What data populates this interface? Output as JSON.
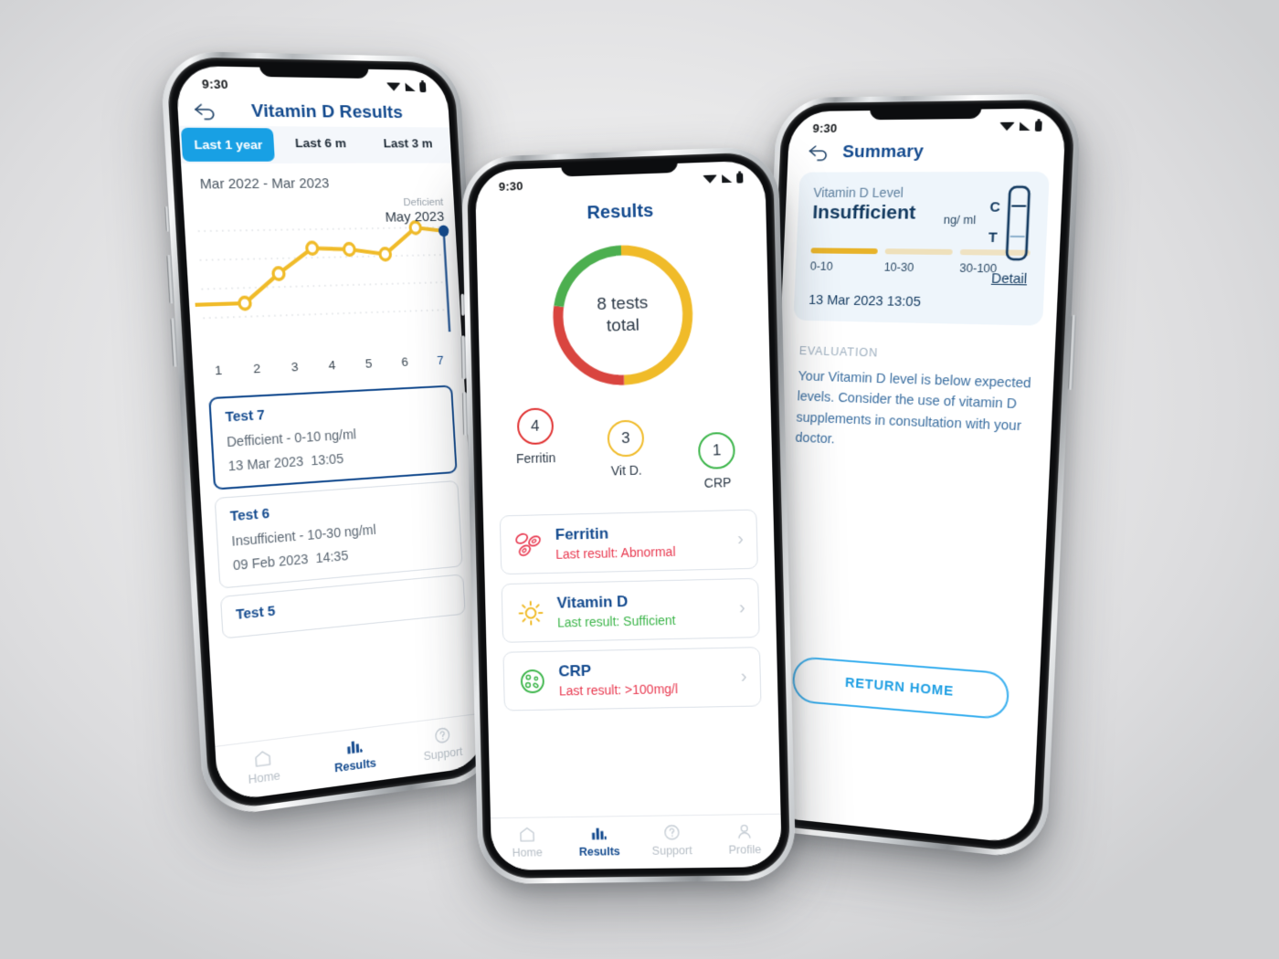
{
  "background": {
    "from": "#f2f2f3",
    "to": "#cfd0d2"
  },
  "brand": {
    "navy": "#134a8e",
    "blue": "#18a0e4",
    "yellow": "#f0bb29",
    "red": "#dc3c3c",
    "green": "#3cb54a"
  },
  "phone_left": {
    "status": {
      "time": "9:30",
      "wifi": "wifi-icon",
      "signal": "signal-icon",
      "battery": "battery-icon"
    },
    "header": {
      "back": "back-arrow-icon",
      "title": "Vitamin D Results"
    },
    "tabs": [
      {
        "label": "Last 1 year",
        "active": true
      },
      {
        "label": "Last 6 m",
        "active": false
      },
      {
        "label": "Last 3 m",
        "active": false
      }
    ],
    "range_label": "Mar 2022 - Mar 2023",
    "chart_annotation": {
      "status": "Deficient",
      "date": "May 2023"
    },
    "tests": [
      {
        "title": "Test 7",
        "result": "Defficient - 0-10 ng/ml",
        "date": "13  Mar 2023",
        "time": "13:05",
        "active": true
      },
      {
        "title": "Test 6",
        "result": "Insufficient - 10-30 ng/ml",
        "date": "09 Feb 2023",
        "time": "14:35",
        "active": false
      },
      {
        "title": "Test 5",
        "result": "",
        "date": "",
        "time": "",
        "active": false
      }
    ],
    "nav": [
      {
        "label": "Home",
        "icon": "home-icon",
        "active": false
      },
      {
        "label": "Results",
        "icon": "bar-chart-icon",
        "active": true
      },
      {
        "label": "Support",
        "icon": "question-circle-icon",
        "active": false
      }
    ]
  },
  "chart_data": {
    "type": "line",
    "title": "Vitamin D Results",
    "subtitle": "Mar 2022 - Mar 2023",
    "xlabel": "",
    "ylabel": "",
    "x": [
      "1",
      "2",
      "3",
      "4",
      "5",
      "6",
      "7"
    ],
    "categories": [
      "1",
      "2",
      "3",
      "4",
      "5",
      "6",
      "7"
    ],
    "values": [
      18,
      34,
      52,
      50,
      47,
      64,
      62
    ],
    "ylim": [
      0,
      80
    ],
    "grid": true,
    "grid_style": "dotted-horizontal",
    "series": [
      {
        "name": "Vitamin D level",
        "color": "#f0bb29",
        "values": [
          18,
          34,
          52,
          50,
          47,
          64,
          62
        ]
      }
    ],
    "highlight": {
      "index": 7,
      "label": "7",
      "color": "#134a8e",
      "annotation_status": "Deficient",
      "annotation_date": "May 2023"
    },
    "legend": "none"
  },
  "phone_center": {
    "status": {
      "time": "9:30"
    },
    "title": "Results",
    "donut": {
      "center_line1": "8 tests",
      "center_line2": "total",
      "total": 8,
      "segments": [
        {
          "name": "Vit D.",
          "value": 4,
          "color": "#f0bb29"
        },
        {
          "name": "Ferritin",
          "value": 3,
          "color": "#dc3c3c"
        },
        {
          "name": "CRP",
          "value": 1,
          "color": "#3cb54a"
        }
      ]
    },
    "counters": [
      {
        "count": "4",
        "label": "Ferritin",
        "color": "#e03232"
      },
      {
        "count": "3",
        "label": "Vit D.",
        "color": "#f0bb29"
      },
      {
        "count": "1",
        "label": "CRP",
        "color": "#3cb54a"
      }
    ],
    "cards": [
      {
        "icon": "blood-cells-icon",
        "name": "Ferritin",
        "sub": "Last result: Abnormal",
        "sub_color": "#e8384f",
        "icon_color": "#e8384f"
      },
      {
        "icon": "sun-icon",
        "name": "Vitamin D",
        "sub": "Last result: Sufficient",
        "sub_color": "#3cb54a",
        "icon_color": "#f0bb29"
      },
      {
        "icon": "crp-cell-icon",
        "name": "CRP",
        "sub": "Last result:  >100mg/l",
        "sub_color": "#e8384f",
        "icon_color": "#3cb54a"
      }
    ],
    "nav": [
      {
        "label": "Home",
        "icon": "home-icon",
        "active": false
      },
      {
        "label": "Results",
        "icon": "bar-chart-icon",
        "active": true
      },
      {
        "label": "Support",
        "icon": "question-circle-icon",
        "active": false
      },
      {
        "label": "Profile",
        "icon": "person-icon",
        "active": false
      }
    ]
  },
  "phone_right": {
    "status": {
      "time": "9:30"
    },
    "header": {
      "back": "back-arrow-icon",
      "title": "Summary"
    },
    "summary": {
      "label": "Vitamin D Level",
      "value": "Insufficient",
      "unit": "ng/ ml",
      "cassette": {
        "c": "C",
        "t": "T",
        "name": "test-cassette-icon"
      },
      "scale": [
        {
          "range": "0-10",
          "color": "#e8b32a"
        },
        {
          "range": "10-30",
          "color": "#eee0bb"
        },
        {
          "range": "30-100",
          "color": "#efe2c2"
        }
      ],
      "detail_link": "Detail",
      "date": "13 Mar 2023  13:05"
    },
    "evaluation": {
      "heading": "EVALUATION",
      "body": "Your Vitamin D level is below expected levels. Consider the use of vitamin D supplements in consultation with your doctor."
    },
    "return_button": "RETURN HOME"
  }
}
